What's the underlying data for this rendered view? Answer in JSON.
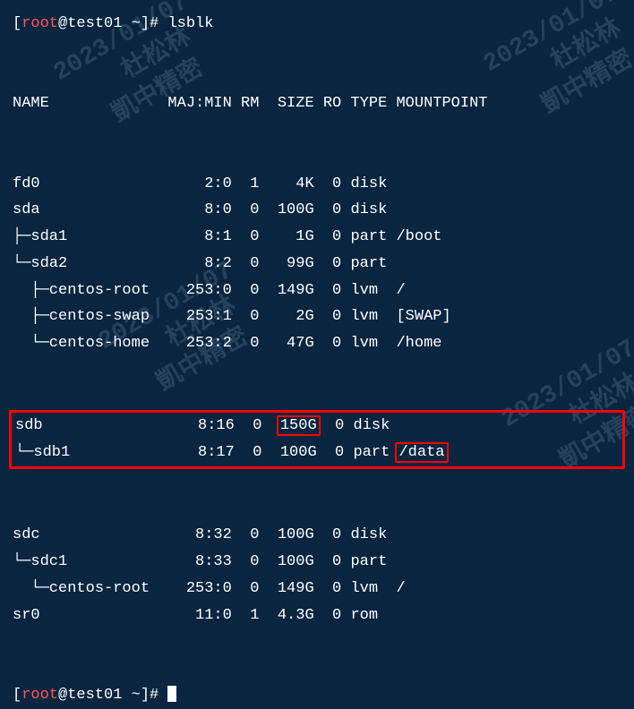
{
  "prompt": {
    "user": "root",
    "host": "test01",
    "path": "~",
    "symbol": "#"
  },
  "command": "lsblk",
  "header": {
    "name": "NAME",
    "majmin": "MAJ:MIN",
    "rm": "RM",
    "size": "SIZE",
    "ro": "RO",
    "type": "TYPE",
    "mount": "MOUNTPOINT"
  },
  "rows": [
    {
      "name": "fd0",
      "maj": "2:0",
      "rm": "1",
      "size": "4K",
      "ro": "0",
      "type": "disk",
      "mount": ""
    },
    {
      "name": "sda",
      "maj": "8:0",
      "rm": "0",
      "size": "100G",
      "ro": "0",
      "type": "disk",
      "mount": ""
    },
    {
      "name": "├─sda1",
      "maj": "8:1",
      "rm": "0",
      "size": "1G",
      "ro": "0",
      "type": "part",
      "mount": "/boot"
    },
    {
      "name": "└─sda2",
      "maj": "8:2",
      "rm": "0",
      "size": "99G",
      "ro": "0",
      "type": "part",
      "mount": ""
    },
    {
      "name": "  ├─centos-root",
      "maj": "253:0",
      "rm": "0",
      "size": "149G",
      "ro": "0",
      "type": "lvm",
      "mount": "/"
    },
    {
      "name": "  ├─centos-swap",
      "maj": "253:1",
      "rm": "0",
      "size": "2G",
      "ro": "0",
      "type": "lvm",
      "mount": "[SWAP]"
    },
    {
      "name": "  └─centos-home",
      "maj": "253:2",
      "rm": "0",
      "size": "47G",
      "ro": "0",
      "type": "lvm",
      "mount": "/home"
    },
    {
      "name": "sdb",
      "maj": "8:16",
      "rm": "0",
      "size": "150G",
      "ro": "0",
      "type": "disk",
      "mount": "",
      "hl": true,
      "box_size": true
    },
    {
      "name": "└─sdb1",
      "maj": "8:17",
      "rm": "0",
      "size": "100G",
      "ro": "0",
      "type": "part",
      "mount": "/data",
      "hl": true,
      "box_mount": true
    },
    {
      "name": "sdc",
      "maj": "8:32",
      "rm": "0",
      "size": "100G",
      "ro": "0",
      "type": "disk",
      "mount": ""
    },
    {
      "name": "└─sdc1",
      "maj": "8:33",
      "rm": "0",
      "size": "100G",
      "ro": "0",
      "type": "part",
      "mount": ""
    },
    {
      "name": "  └─centos-root",
      "maj": "253:0",
      "rm": "0",
      "size": "149G",
      "ro": "0",
      "type": "lvm",
      "mount": "/"
    },
    {
      "name": "sr0",
      "maj": "11:0",
      "rm": "1",
      "size": "4.3G",
      "ro": "0",
      "type": "rom",
      "mount": ""
    }
  ],
  "watermark": "2023/01/07\n    杜松林\n  凱中精密"
}
